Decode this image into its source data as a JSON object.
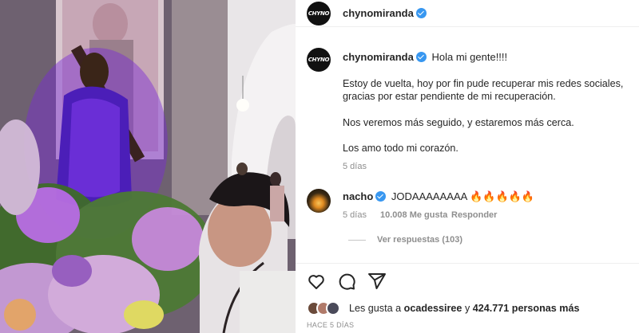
{
  "post": {
    "username": "chynomiranda",
    "avatar_text": "CHYNO"
  },
  "caption": {
    "username": "chynomiranda",
    "greeting": "Hola mi gente!!!!",
    "line2": "Estoy de vuelta, hoy por fin pude recuperar mis redes sociales,",
    "line3": "gracias por estar pendiente de mi recuperación.",
    "line4": "Nos veremos más seguido, y estaremos más cerca.",
    "line5": "Los amo todo mi corazón.",
    "time": "5 días"
  },
  "comment": {
    "username": "nacho",
    "text": "JODAAAAAAAA 🔥🔥🔥🔥🔥",
    "time": "5 días",
    "likes": "10.008 Me gusta",
    "reply": "Responder",
    "view_replies": "Ver respuestas (103)"
  },
  "likes": {
    "prefix": "Les gusta a ",
    "user": "ocadessiree",
    "middle": " y ",
    "count": "424.771 personas más"
  },
  "posted": "HACE 5 DÍAS",
  "icons": {
    "like": "heart-icon",
    "comment": "comment-icon",
    "share": "share-icon"
  },
  "colors": {
    "verified": "#3897f0",
    "muted": "#8e8e8e",
    "text": "#262626"
  }
}
